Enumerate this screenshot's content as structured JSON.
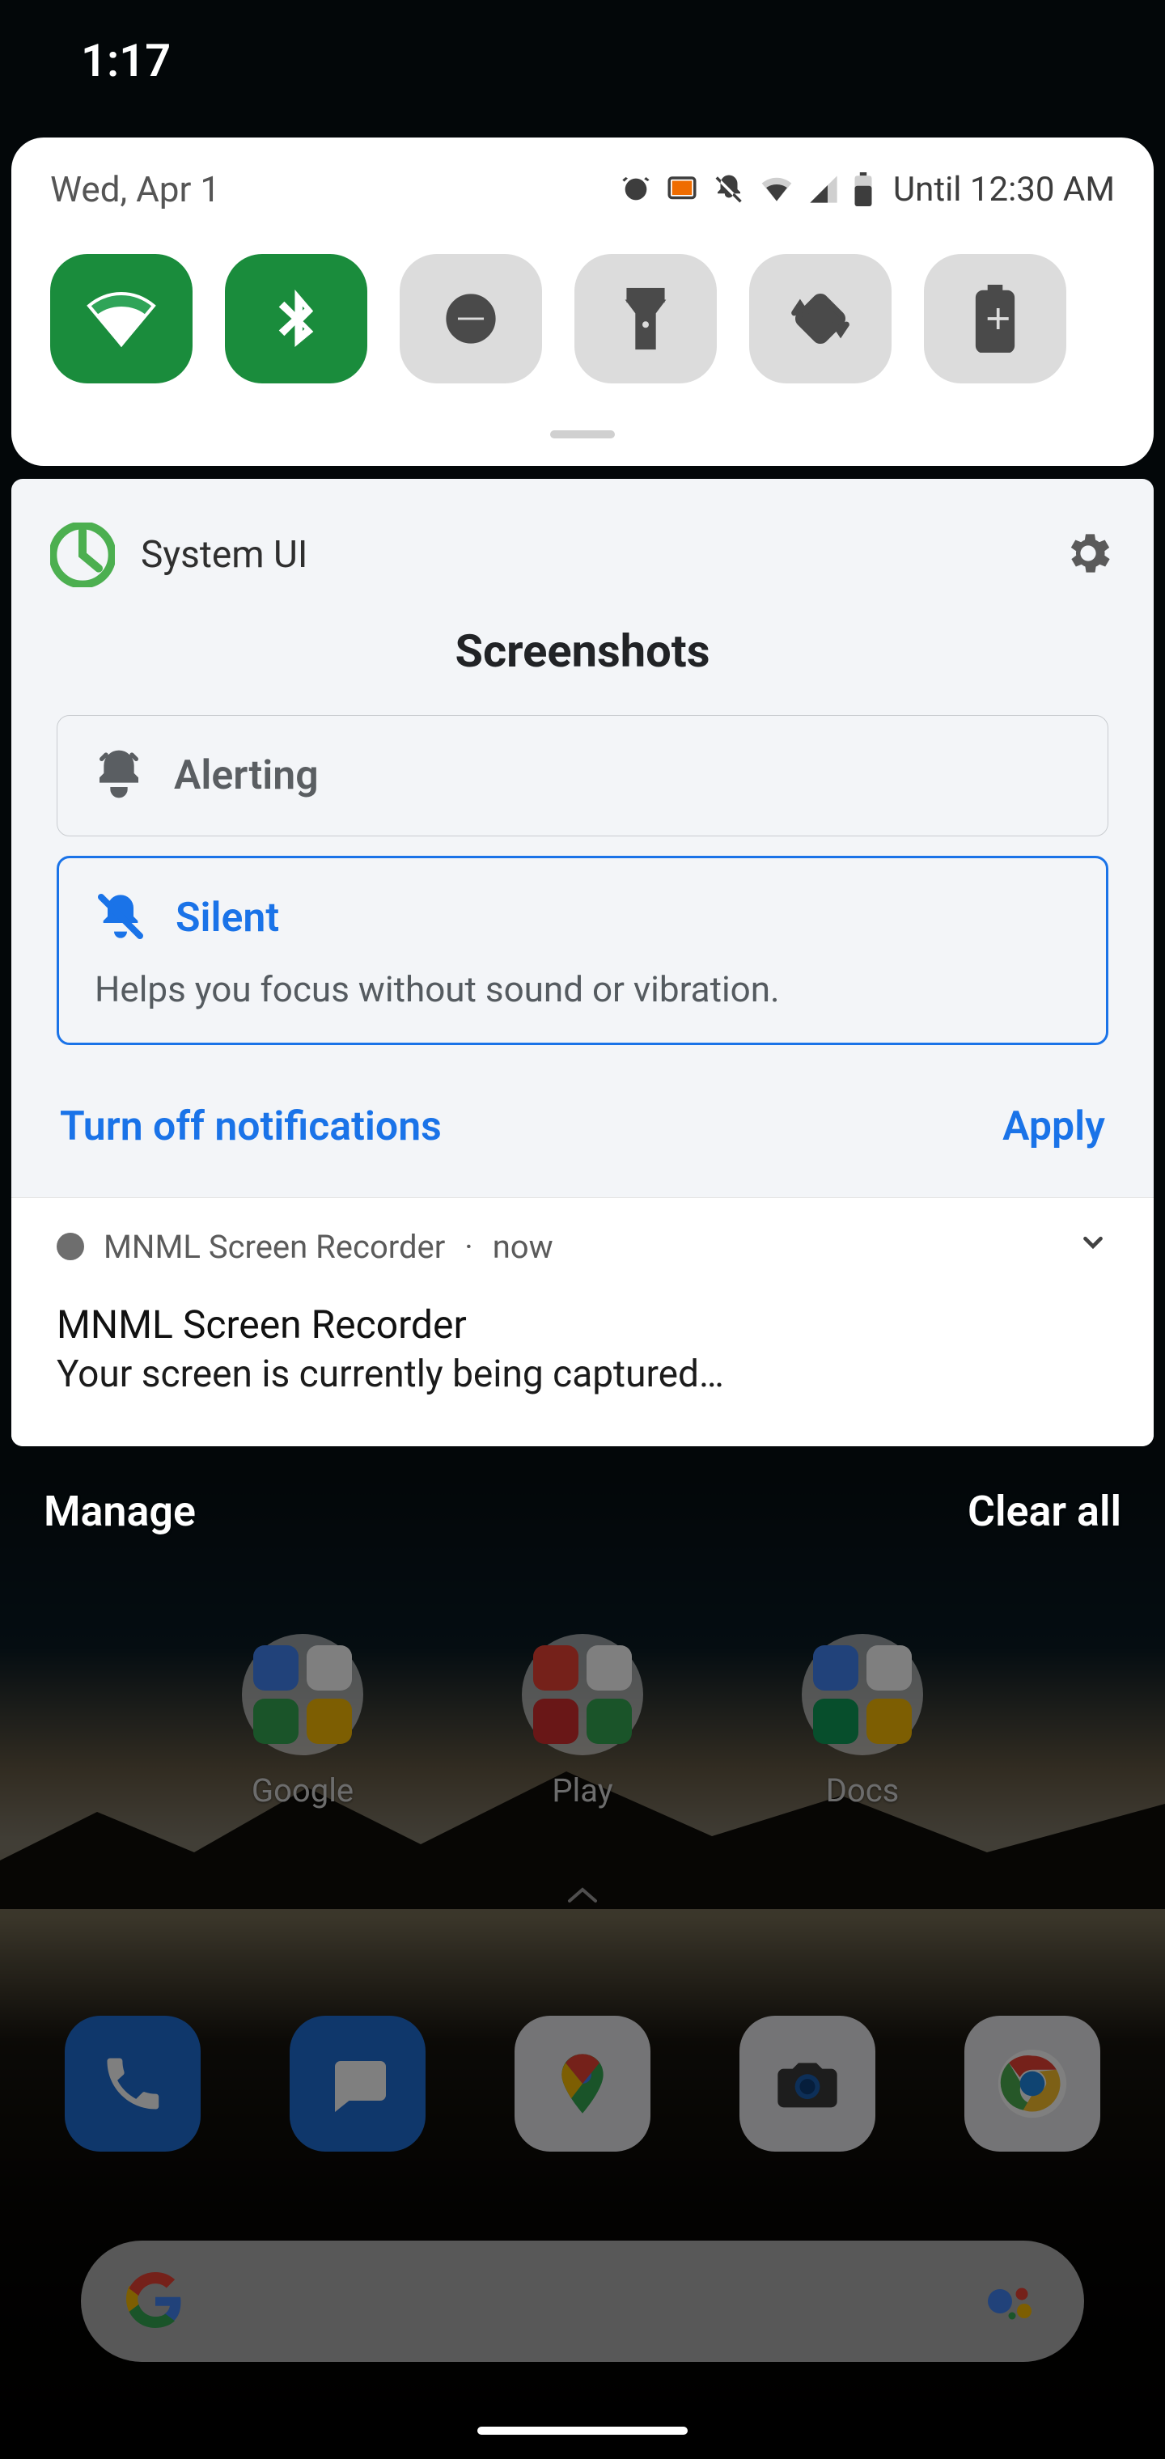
{
  "statusbar": {
    "clock": "1:17"
  },
  "quick_settings": {
    "date": "Wed, Apr 1",
    "until": "Until 12:30 AM",
    "tiles": [
      {
        "name": "wifi",
        "on": true
      },
      {
        "name": "bluetooth",
        "on": true
      },
      {
        "name": "dnd",
        "on": false
      },
      {
        "name": "flashlight",
        "on": false
      },
      {
        "name": "autorotate",
        "on": false
      },
      {
        "name": "battery-saver",
        "on": false
      }
    ]
  },
  "channel_card": {
    "app_name": "System UI",
    "title": "Screenshots",
    "options": {
      "alerting": {
        "label": "Alerting"
      },
      "silent": {
        "label": "Silent",
        "desc": "Helps you focus without sound or vibration."
      }
    },
    "actions": {
      "turn_off": "Turn off notifications",
      "apply": "Apply"
    }
  },
  "notification": {
    "app": "MNML Screen Recorder",
    "sep": " · ",
    "time": "now",
    "title": "MNML Screen Recorder",
    "body": "Your screen is currently being captured…"
  },
  "shade_footer": {
    "manage": "Manage",
    "clear": "Clear all"
  },
  "home": {
    "folders": [
      {
        "label": "Google",
        "colors": [
          "#4285f4",
          "#fff",
          "#34a853",
          "#fbbc05"
        ]
      },
      {
        "label": "Play",
        "colors": [
          "#ea4335",
          "#fff",
          "#d32f2f",
          "#34a853"
        ]
      },
      {
        "label": "Docs",
        "colors": [
          "#4285f4",
          "#fff",
          "#0f9d58",
          "#fbbc05"
        ]
      }
    ]
  },
  "colors": {
    "accent": "#1a73e8",
    "tile_on": "#1a8c3c"
  }
}
